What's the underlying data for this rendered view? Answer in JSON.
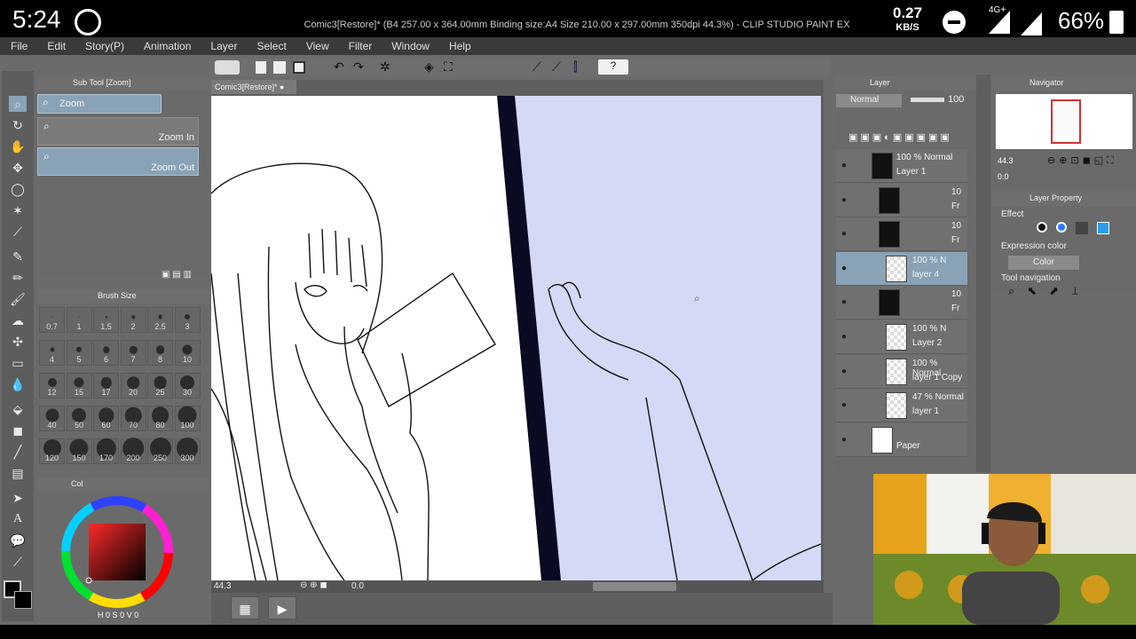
{
  "status": {
    "time": "5:24",
    "speed_value": "0.27",
    "speed_unit": "KB/S",
    "network": "4G+",
    "battery": "66%"
  },
  "window_title": "Comic3[Restore]* (B4 257.00 x 364.00mm Binding size:A4 Size 210.00 x 297.00mm 350dpi 44.3%) - CLIP STUDIO PAINT EX",
  "menu": [
    "File",
    "Edit",
    "Story(P)",
    "Animation",
    "Layer",
    "Select",
    "View",
    "Filter",
    "Window",
    "Help"
  ],
  "subtool": {
    "tab": "Sub Tool [Zoom]",
    "group": "Zoom",
    "items": [
      {
        "label": "Zoom In"
      },
      {
        "label": "Zoom Out"
      }
    ]
  },
  "brush_size": {
    "tab": "Brush Size",
    "sizes": [
      "0.7",
      "1",
      "1.5",
      "2",
      "2.5",
      "3",
      "4",
      "5",
      "6",
      "7",
      "8",
      "10",
      "12",
      "15",
      "17",
      "20",
      "25",
      "30",
      "40",
      "50",
      "60",
      "70",
      "80",
      "100",
      "120",
      "150",
      "170",
      "200",
      "250",
      "300"
    ]
  },
  "color_panel": {
    "tab": "Col",
    "hsv": [
      "H",
      "0",
      "S",
      "0",
      "V",
      "0"
    ]
  },
  "document_tab": "Comic3[Restore]*",
  "canvas_bottom": {
    "zoom": "44.3",
    "angle": "0.0"
  },
  "layer_panel": {
    "tab": "Layer",
    "blend_mode": "Normal",
    "opacity": "100",
    "layers": [
      {
        "line1": "100 % Normal",
        "line2": "Layer 1",
        "thumb": "black"
      },
      {
        "line1": "10",
        "line2": "Fr",
        "thumb": "folder"
      },
      {
        "line1": "10",
        "line2": "Fr",
        "thumb": "folder"
      },
      {
        "line1": "100 % N",
        "line2": "layer 4",
        "thumb": "checker",
        "selected": true
      },
      {
        "line1": "10",
        "line2": "Fr",
        "thumb": "folder"
      },
      {
        "line1": "100 % N",
        "line2": "Layer 2",
        "thumb": "checker"
      },
      {
        "line1": "100 % Normal",
        "line2": "layer 1 Copy",
        "thumb": "checker"
      },
      {
        "line1": "47 % Normal",
        "line2": "layer 1",
        "thumb": "checker"
      },
      {
        "line1": "",
        "line2": "Paper",
        "thumb": "white"
      }
    ]
  },
  "navigator": {
    "tab": "Navigator",
    "zoom": "44.3",
    "angle": "0.0"
  },
  "layer_property": {
    "tab": "Layer Property",
    "effect_label": "Effect",
    "expression_color_label": "Expression color",
    "expression_color_value": "Color",
    "tool_navigation_label": "Tool navigation"
  },
  "colors": {
    "panel": "#6a6a6a",
    "selection": "#8aa2b6",
    "canvas_right": "#d4d9f5",
    "frame_border": "#0a0a22"
  }
}
